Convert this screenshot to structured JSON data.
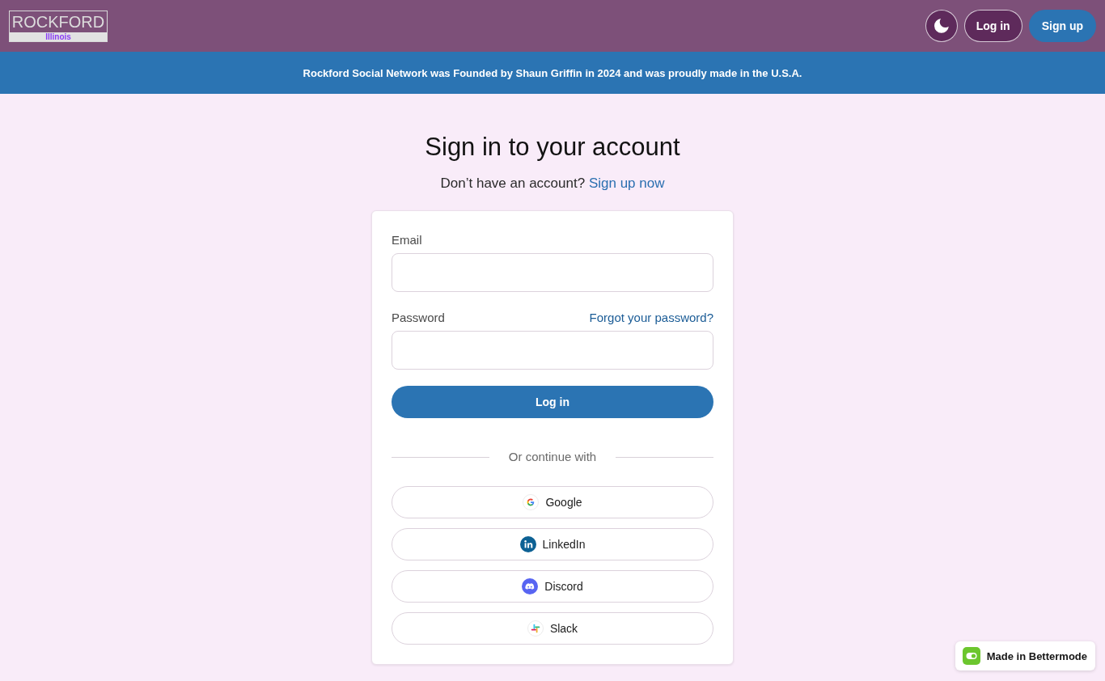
{
  "header": {
    "logo": {
      "title": "ROCKFORD",
      "subtitle": "Illinois"
    },
    "buttons": [
      {
        "kind": "theme"
      },
      {
        "kind": "outline",
        "label": "Log in"
      },
      {
        "kind": "primary",
        "label": "Sign up"
      }
    ]
  },
  "banner": {
    "text": "Rockford Social Network was Founded by Shaun Griffin in 2024 and was proudly made in the U.S.A."
  },
  "main": {
    "title": "Sign in to your account",
    "prompt": "Don’t have an account?",
    "prompt_link": "Sign up now"
  },
  "form": {
    "fields": [
      {
        "label": "Email"
      },
      {
        "label": "Password",
        "link": "Forgot your password?"
      }
    ],
    "submit": "Log in",
    "divider": "Or continue with",
    "providers": [
      {
        "kind": "google",
        "label": "Google"
      },
      {
        "kind": "linkedin",
        "label": "LinkedIn"
      },
      {
        "kind": "discord",
        "label": "Discord"
      },
      {
        "kind": "slack",
        "label": "Slack"
      }
    ]
  },
  "badge": {
    "label": "Made in Bettermode"
  }
}
